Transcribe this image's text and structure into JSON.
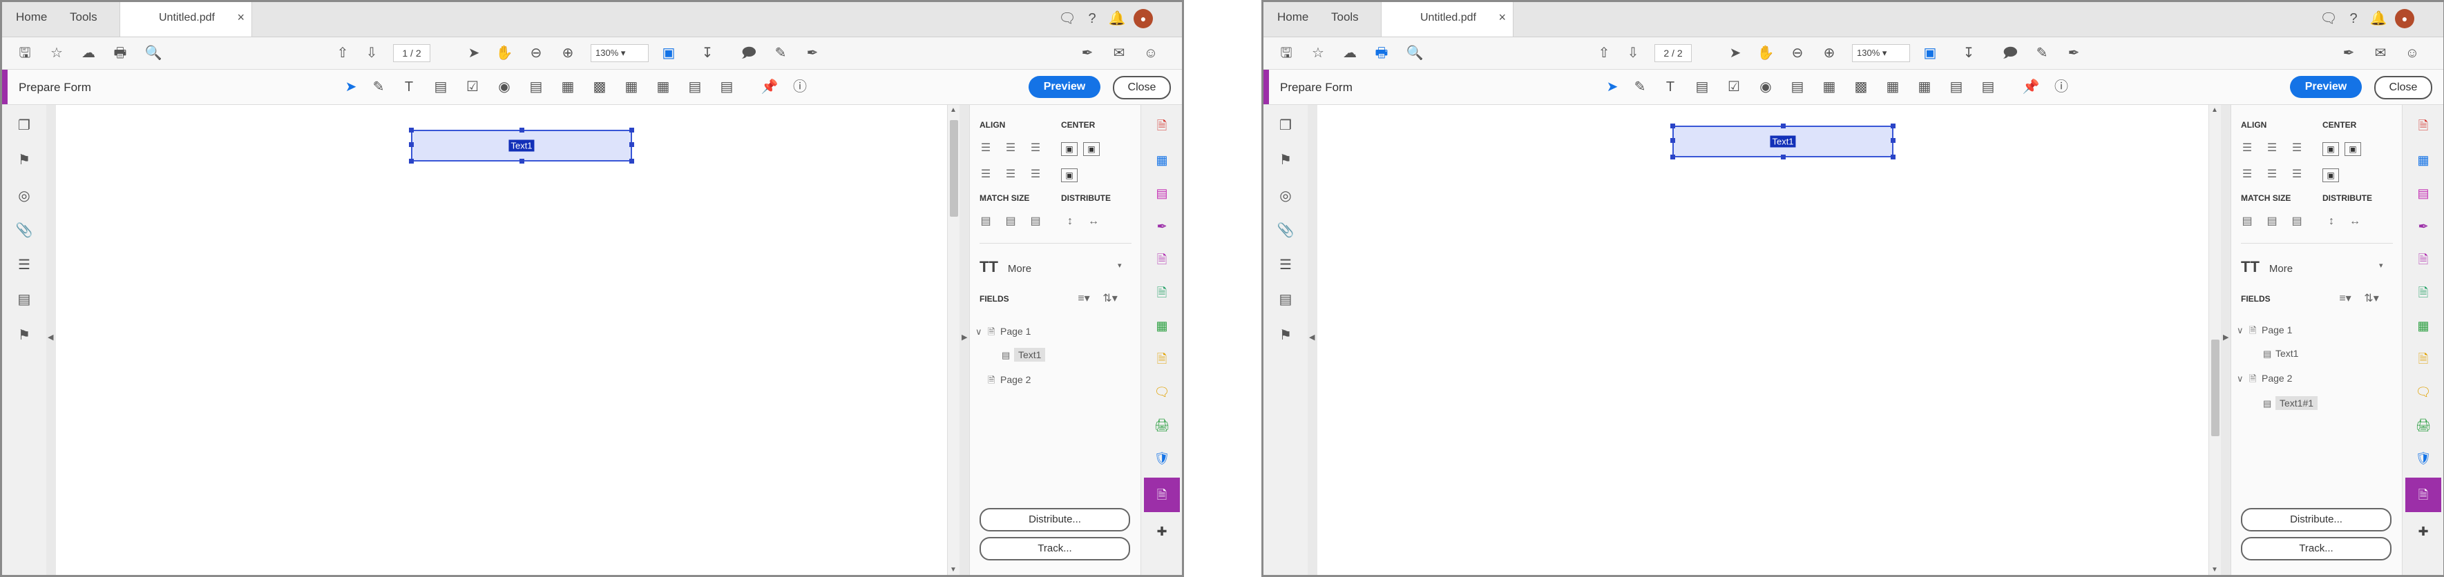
{
  "colors": {
    "accent": "#9c2fa8",
    "preview": "#1473e6",
    "field_fill": "#dde3fb",
    "field_border": "#3856d6"
  },
  "panels": [
    {
      "tabs": {
        "home": "Home",
        "tools": "Tools",
        "document": "Untitled.pdf",
        "close_glyph": "×"
      },
      "toolbar": {
        "page_current": "1",
        "page_total": "/ 2",
        "zoom": "130%"
      },
      "formbar": {
        "title": "Prepare Form",
        "preview": "Preview",
        "close": "Close"
      },
      "field": {
        "label": "Text1"
      },
      "rightpane": {
        "align": "ALIGN",
        "center": "CENTER",
        "match_size": "MATCH SIZE",
        "distribute": "DISTRIBUTE",
        "more": "More",
        "fields": "FIELDS",
        "tree": [
          {
            "kind": "page",
            "label": "Page 1",
            "expanded": true
          },
          {
            "kind": "field",
            "label": "Text1",
            "selected": true
          },
          {
            "kind": "page",
            "label": "Page 2",
            "expanded": false
          }
        ],
        "distribute_btn": "Distribute...",
        "track_btn": "Track..."
      }
    },
    {
      "tabs": {
        "home": "Home",
        "tools": "Tools",
        "document": "Untitled.pdf",
        "close_glyph": "×"
      },
      "toolbar": {
        "page_current": "2",
        "page_total": "/ 2",
        "zoom": "130%"
      },
      "formbar": {
        "title": "Prepare Form",
        "preview": "Preview",
        "close": "Close"
      },
      "field": {
        "label": "Text1"
      },
      "rightpane": {
        "align": "ALIGN",
        "center": "CENTER",
        "match_size": "MATCH SIZE",
        "distribute": "DISTRIBUTE",
        "more": "More",
        "fields": "FIELDS",
        "tree": [
          {
            "kind": "page",
            "label": "Page 1",
            "expanded": true
          },
          {
            "kind": "field",
            "label": "Text1",
            "selected": false
          },
          {
            "kind": "page",
            "label": "Page 2",
            "expanded": true
          },
          {
            "kind": "field",
            "label": "Text1#1",
            "selected": true
          }
        ],
        "distribute_btn": "Distribute...",
        "track_btn": "Track..."
      }
    }
  ]
}
